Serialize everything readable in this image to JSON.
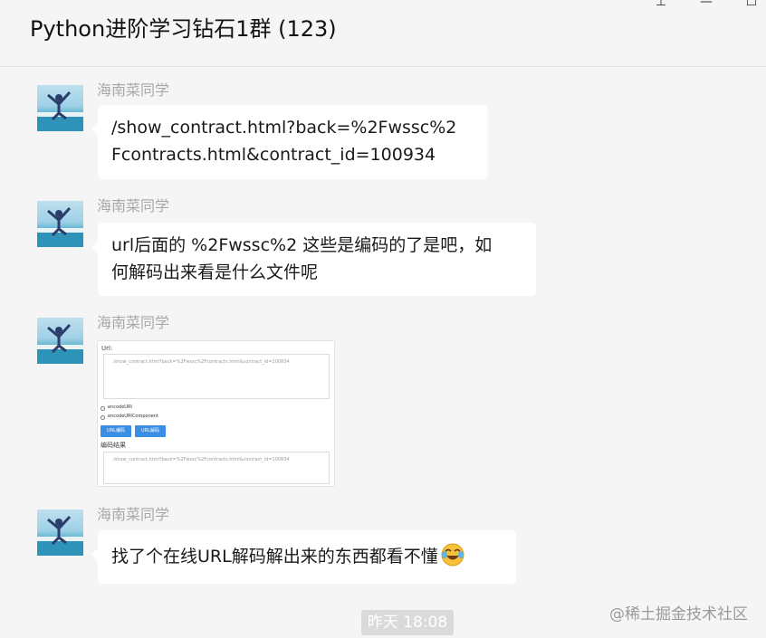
{
  "window": {
    "title": "Python进阶学习钻石1群 (123)",
    "controls": {
      "pin": "⊥",
      "minimize": "—",
      "maximize": "☐"
    }
  },
  "messages": [
    {
      "sender": "海南菜同学",
      "text_lines": [
        "/show_contract.html?back=%2Fwssc%2",
        "Fcontracts.html&contract_id=100934"
      ]
    },
    {
      "sender": "海南菜同学",
      "text_lines": [
        "url后面的 %2Fwssc%2 这些是编码的了是吧，如",
        "何解码出来看是什么文件呢"
      ]
    },
    {
      "sender": "海南菜同学",
      "image": {
        "label_top": "Url:",
        "input_text": "/show_contract.html?back=%2Fwssc%2Fcontracts.html&contract_id=100934",
        "options": [
          "encodeURI",
          "encodeURIComponent"
        ],
        "buttons": [
          "URL编码",
          "URL解码"
        ],
        "label_bottom": "编码结果",
        "output_text": "/show_contract.html?back=%2Fwssc%2Fcontracts.html&contract_id=100934"
      }
    },
    {
      "sender": "海南菜同学",
      "text": "找了个在线URL解码解出来的东西都看不懂",
      "emoji": "crying-laughing-emoji"
    }
  ],
  "timestamp": "昨天 18:08",
  "watermark": "@稀土掘金技术社区",
  "colors": {
    "background": "#f5f5f5",
    "bubble": "#ffffff",
    "sender": "#a8a8a8",
    "timestamp_bg": "#dadada",
    "button_blue": "#3a8ee6"
  }
}
